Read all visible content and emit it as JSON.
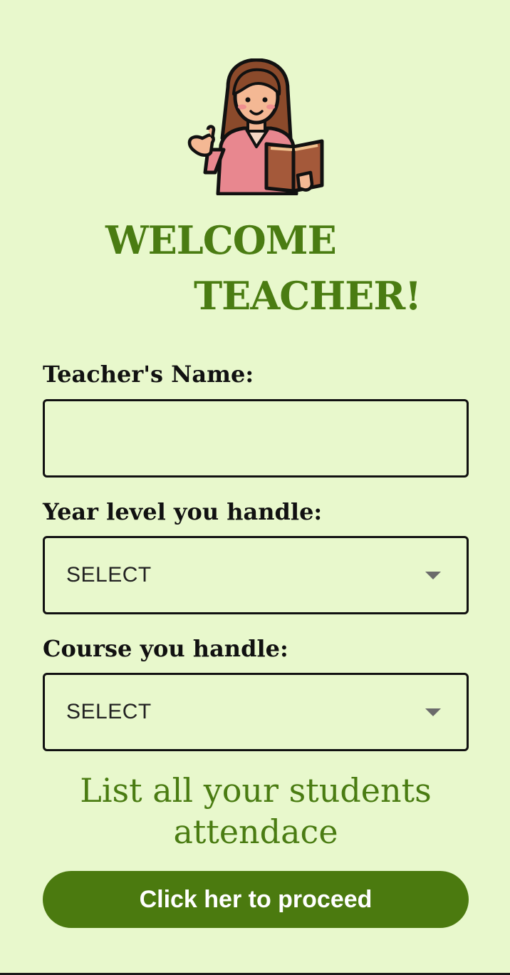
{
  "welcome": {
    "line1": "WELCOME",
    "line2": "TEACHER!"
  },
  "form": {
    "name_label": "Teacher's Name:",
    "name_value": "",
    "year_label": "Year level you handle:",
    "year_value": "SELECT",
    "course_label": "Course you handle:",
    "course_value": "SELECT"
  },
  "info": {
    "text": "List all your students attendace"
  },
  "proceed_button": {
    "label": "Click her to proceed"
  },
  "icons": {
    "illustration": "teacher-with-book-icon",
    "dropdown": "chevron-down-icon"
  },
  "colors": {
    "background": "#e8f8cc",
    "accent": "#4a7c12",
    "button": "#4b7a0f"
  }
}
